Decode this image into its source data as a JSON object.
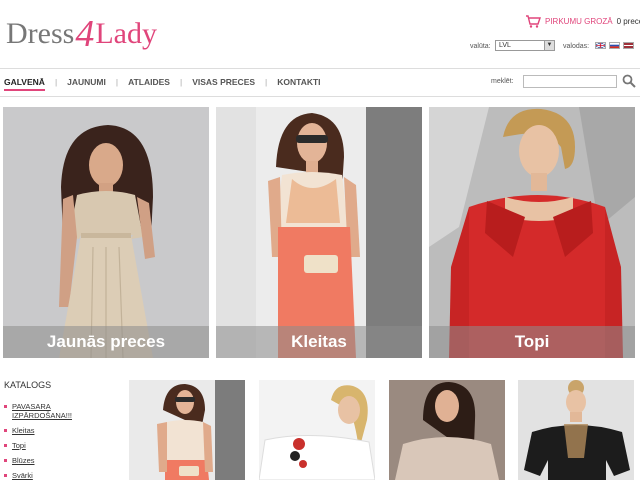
{
  "logo": {
    "part1": "Dress",
    "part2": "4",
    "part3": "Lady"
  },
  "cart": {
    "label": "PIRKUMU GROZĀ",
    "count": "0 preces",
    "icon": "shopping-cart-icon"
  },
  "currency": {
    "label": "valūta:",
    "selected": "LVL"
  },
  "language": {
    "label": "valodas:",
    "flags": [
      "english",
      "russian",
      "latvian"
    ]
  },
  "nav": {
    "items": [
      "GALVENĀ",
      "JAUNUMI",
      "ATLAIDES",
      "VISAS PRECES",
      "KONTAKTI"
    ],
    "active": "GALVENĀ"
  },
  "search": {
    "label": "meklēt:",
    "placeholder": ""
  },
  "banners": [
    {
      "caption": "Jaunās preces"
    },
    {
      "caption": "Kleitas"
    },
    {
      "caption": "Topi"
    }
  ],
  "catalog": {
    "title": "KATALOGS",
    "items": [
      "PAVASARA IZPĀRDOŠANA!!!",
      "Kleitas",
      "Topi",
      "Blūzes",
      "Svārki"
    ]
  },
  "colors": {
    "accent": "#e0457b",
    "nav_text": "#555555",
    "caption_bg": "#8c8c8c"
  }
}
